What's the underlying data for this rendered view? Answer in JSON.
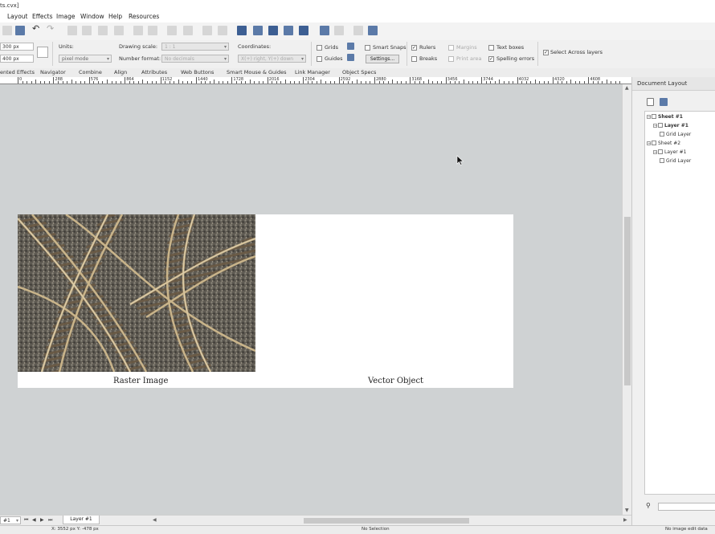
{
  "title_fragment": "ts.cvx]",
  "menu": [
    "Layout",
    "Effects",
    "Image",
    "Window",
    "Help",
    "Resources"
  ],
  "settings": {
    "width_value": "300 px",
    "height_value": "400 px",
    "units_label": "Units:",
    "units_value": "pixel mode",
    "drawing_scale_label": "Drawing scale:",
    "drawing_scale_value": "1 : 1",
    "number_format_label": "Number format:",
    "number_format_value": "No decimals",
    "coordinates_label": "Coordinates:",
    "coordinates_value": "X(+) right, Y(+) down",
    "grids_label": "Grids",
    "guides_label": "Guides",
    "smart_snaps_label": "Smart Snaps",
    "settings_button": "Settings...",
    "rulers_label": "Rulers",
    "breaks_label": "Breaks",
    "margins_label": "Margins",
    "print_area_label": "Print area",
    "text_boxes_label": "Text boxes",
    "spelling_errors_label": "Spelling errors",
    "select_across_layers_label": "Select Across layers"
  },
  "tabs": [
    "ented Effects",
    "Navigator",
    "Combine",
    "Align",
    "Attributes",
    "Web Buttons",
    "Smart Mouse & Guides",
    "Link Manager",
    "Object Specs"
  ],
  "ruler_ticks": [
    "0",
    "288",
    "576",
    "864",
    "1152",
    "1440",
    "1728",
    "2016",
    "2304",
    "2592",
    "2880",
    "3168",
    "3456",
    "3744",
    "4032",
    "4320",
    "4608"
  ],
  "canvas": {
    "raster_caption": "Raster Image",
    "vector_caption": "Vector Object"
  },
  "panel": {
    "title": "Document Layout",
    "tree": {
      "sheet1": "Sheet #1",
      "sheet1_layer": "Layer #1",
      "sheet1_grid": "Grid Layer",
      "sheet2": "Sheet #2",
      "sheet2_layer": "Layer #1",
      "sheet2_grid": "Grid Layer"
    }
  },
  "bottom": {
    "page_select": "#1",
    "layer_tab": "Layer #1"
  },
  "status": {
    "coords": "X: 3552 px Y: -478 px",
    "selection": "No Selection",
    "info": "No image edit data"
  }
}
